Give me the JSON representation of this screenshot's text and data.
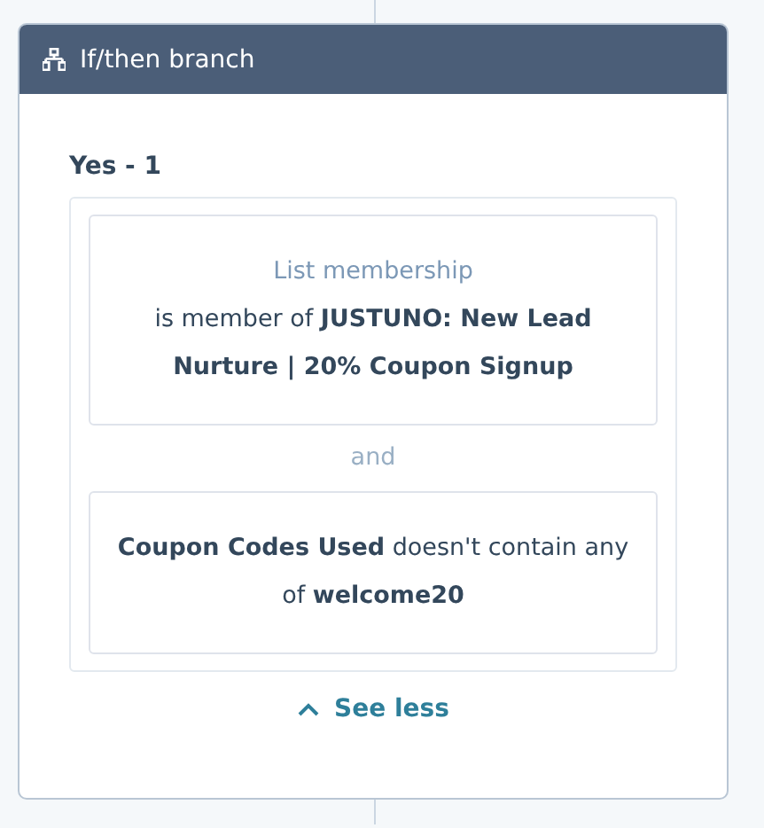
{
  "card": {
    "title": "If/then branch"
  },
  "branch": {
    "label": "Yes - 1",
    "filters": [
      {
        "heading": "List membership",
        "text": "is member of **JUSTUNO: New Lead Nurture | 20% Coupon Signup**"
      },
      {
        "text": "**Coupon Codes Used** doesn't contain any of **welcome20**"
      }
    ],
    "joiner": "and"
  },
  "toggle": {
    "label": "See less",
    "expanded": true
  }
}
